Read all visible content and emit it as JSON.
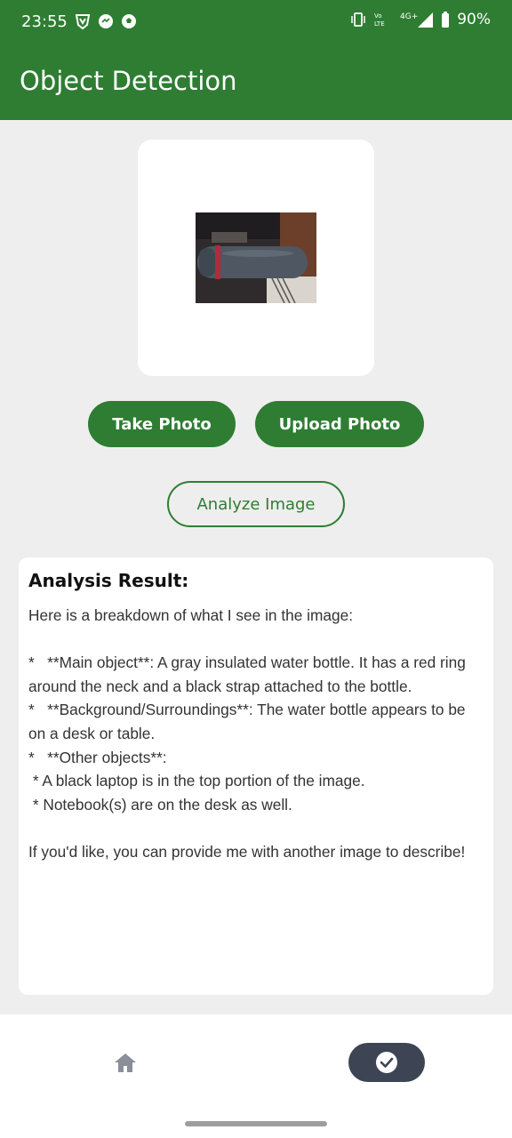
{
  "status_bar": {
    "time": "23:55",
    "battery": "90%",
    "network": "4G+",
    "volte": "Vo LTE",
    "left_icons": [
      "vpn-shield-icon",
      "messenger-icon",
      "soccer-ball-icon"
    ],
    "right_icons": [
      "vibrate-icon",
      "volte-icon",
      "signal-icon",
      "battery-icon"
    ]
  },
  "app_bar": {
    "title": "Object Detection"
  },
  "image_preview": {
    "icon": "photo-preview"
  },
  "actions": {
    "take_photo": "Take Photo",
    "upload_photo": "Upload Photo",
    "analyze_image": "Analyze Image"
  },
  "result": {
    "title": "Analysis Result:",
    "body": "Here is a breakdown of what I see in the image:\n\n*   **Main object**: A gray insulated water bottle. It has a red ring around the neck and a black strap attached to the bottle.\n*   **Background/Surroundings**: The water bottle appears to be on a desk or table.\n*   **Other objects**:\n * A black laptop is in the top portion of the image.\n * Notebook(s) are on the desk as well.\n\nIf you'd like, you can provide me with another image to describe!"
  },
  "bottom_nav": {
    "items": [
      {
        "icon": "home-icon",
        "selected": false
      },
      {
        "icon": "check-circle-icon",
        "selected": true
      }
    ]
  },
  "colors": {
    "primary": "#2e7d32",
    "background": "#eeeeee",
    "nav_selected": "#3d4454"
  }
}
